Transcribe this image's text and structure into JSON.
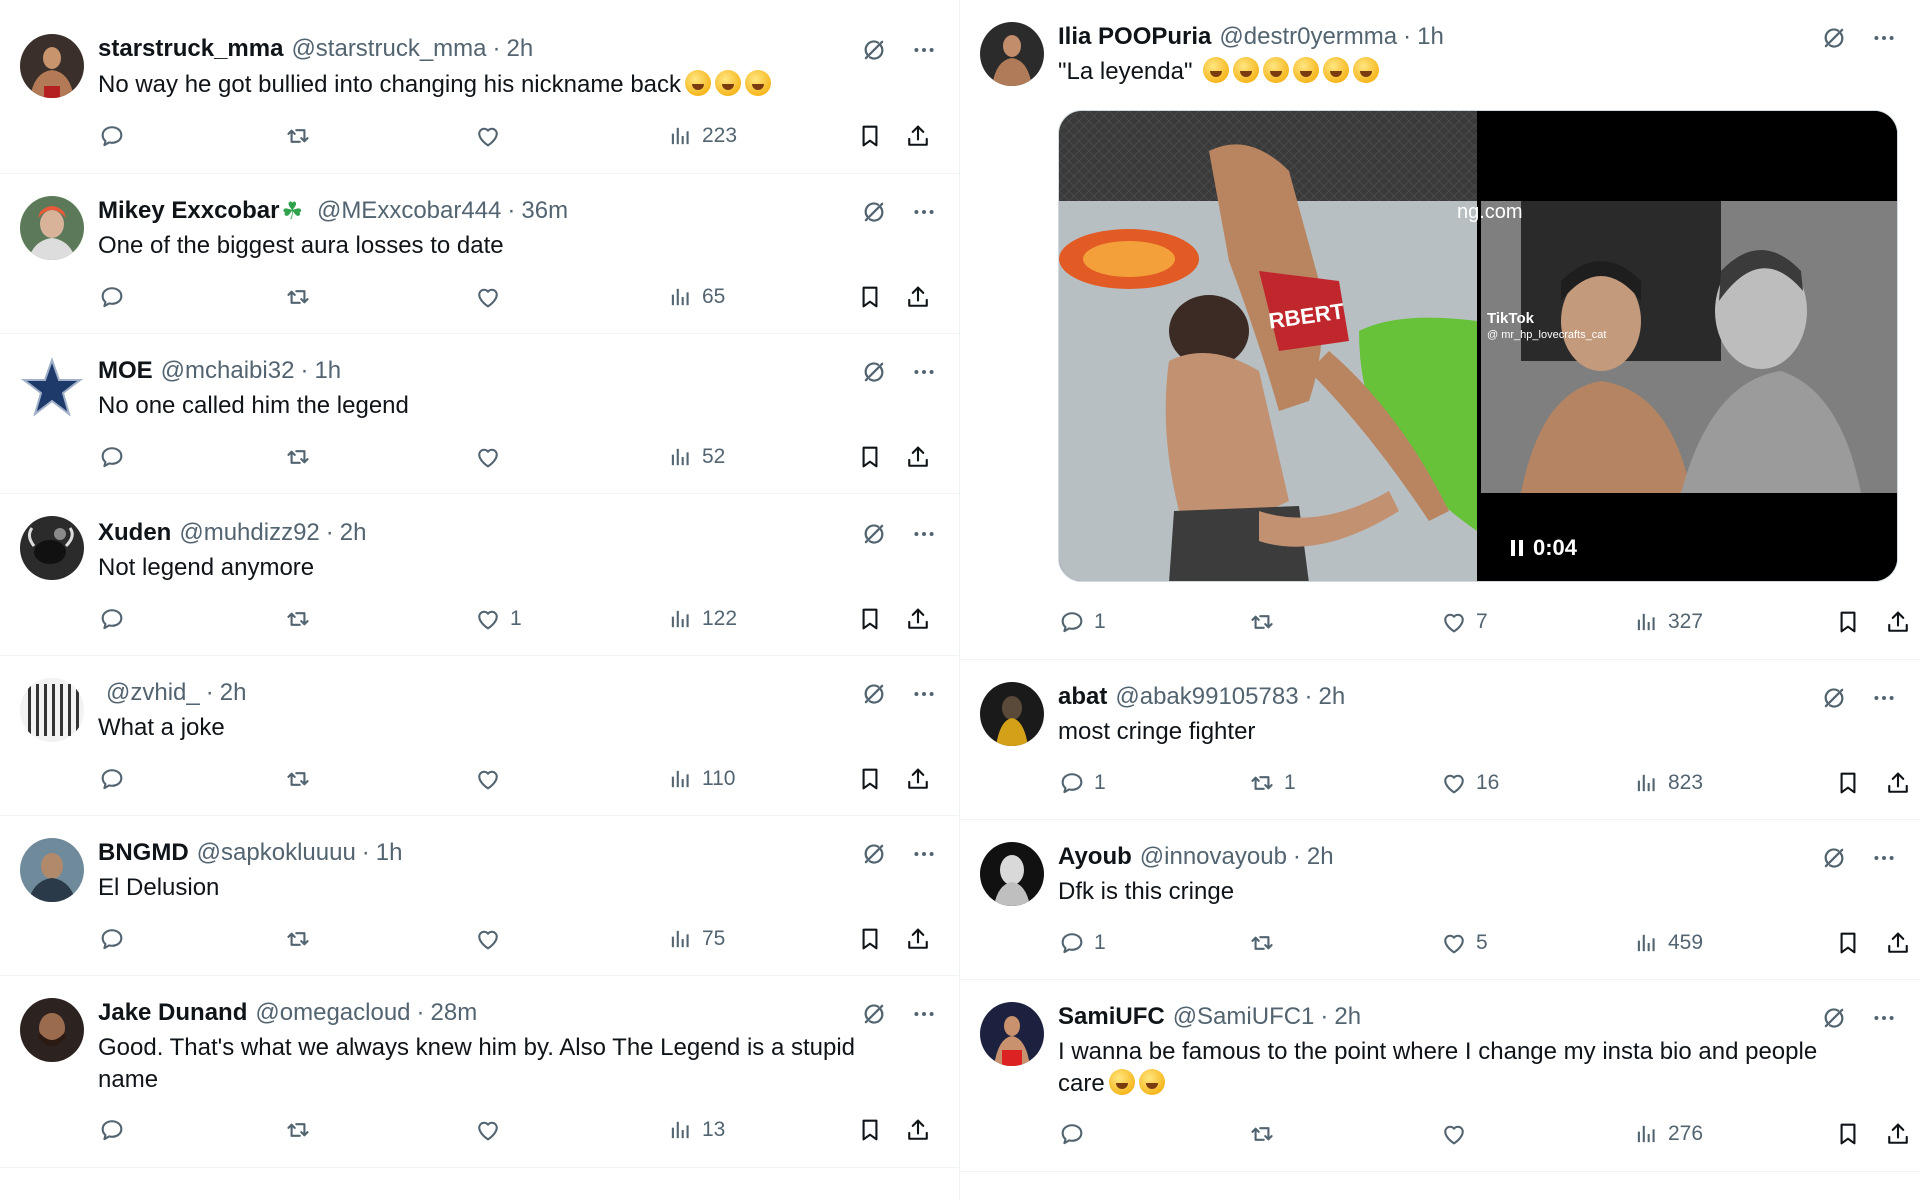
{
  "left_column": [
    {
      "name": "starstruck_mma",
      "handle": "@starstruck_mma",
      "time": "2h",
      "text": "No way he got bullied into changing his nickname back",
      "emoji_count": 3,
      "replies": "",
      "reposts": "",
      "likes": "",
      "views": "223"
    },
    {
      "name": "Mikey Exxcobar",
      "name_suffix": "☘",
      "handle": "@MExxcobar444",
      "time": "36m",
      "text": "One of the biggest aura losses to date",
      "replies": "",
      "reposts": "",
      "likes": "",
      "views": "65"
    },
    {
      "name": "MOE",
      "handle": "@mchaibi32",
      "time": "1h",
      "text": "No one called him the legend",
      "replies": "",
      "reposts": "",
      "likes": "",
      "views": "52"
    },
    {
      "name": "Xuden",
      "handle": "@muhdizz92",
      "time": "2h",
      "text": "Not legend anymore",
      "replies": "",
      "reposts": "",
      "likes": "1",
      "views": "122"
    },
    {
      "name": "",
      "handle": "@zvhid_",
      "time": "2h",
      "text": "What a joke",
      "replies": "",
      "reposts": "",
      "likes": "",
      "views": "110"
    },
    {
      "name": "BNGMD",
      "handle": "@sapkokluuuu",
      "time": "1h",
      "text": "El Delusion",
      "replies": "",
      "reposts": "",
      "likes": "",
      "views": "75"
    },
    {
      "name": "Jake Dunand",
      "handle": "@omegacloud",
      "time": "28m",
      "text": "Good. That's what we always knew him by. Also The Legend is a stupid name",
      "replies": "",
      "reposts": "",
      "likes": "",
      "views": "13"
    }
  ],
  "right_column": [
    {
      "name": "Ilia POOPuria",
      "handle": "@destr0yermma",
      "time": "1h",
      "text": "\"La leyenda\"",
      "emoji_count": 6,
      "replies": "1",
      "reposts": "",
      "likes": "7",
      "views": "327",
      "media": {
        "duration": "0:04",
        "watermark": "ng.com",
        "tiktok_label": "TikTok",
        "tiktok_user": "@ mr_hp_lovecrafts_cat",
        "short_label": "RBERT"
      }
    },
    {
      "name": "abat",
      "handle": "@abak99105783",
      "time": "2h",
      "text": "most cringe fighter",
      "replies": "1",
      "reposts": "1",
      "likes": "16",
      "views": "823"
    },
    {
      "name": "Ayoub",
      "handle": "@innovayoub",
      "time": "2h",
      "text": "Dfk is this cringe",
      "replies": "1",
      "reposts": "",
      "likes": "5",
      "views": "459"
    },
    {
      "name": "SamiUFC",
      "handle": "@SamiUFC1",
      "time": "2h",
      "text": "I wanna be famous to the point where I change my insta bio and people care",
      "emoji_count": 2,
      "replies": "",
      "reposts": "",
      "likes": "",
      "views": "276"
    }
  ],
  "icons": {
    "reply": "speech-bubble-icon",
    "repost": "repost-arrows-icon",
    "like": "heart-icon",
    "views": "bar-chart-icon",
    "bookmark": "bookmark-icon",
    "share": "upload-share-icon",
    "grok": "grok-slash-icon",
    "more": "ellipsis-icon"
  },
  "colors": {
    "text": "#0f1419",
    "secondary": "#536471",
    "border": "#eff3f4"
  }
}
